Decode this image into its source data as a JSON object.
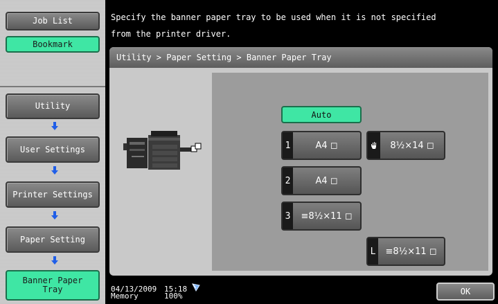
{
  "header": {
    "message_line1": "Specify the banner paper tray to be used when it is not specified",
    "message_line2": "from the printer driver."
  },
  "sidebar": {
    "job_list": "Job List",
    "bookmark": "Bookmark",
    "items": [
      {
        "label": "Utility"
      },
      {
        "label": "User Settings"
      },
      {
        "label": "Printer Settings"
      },
      {
        "label": "Paper Setting"
      },
      {
        "label_line1": "Banner Paper",
        "label_line2": "Tray"
      }
    ]
  },
  "breadcrumb": "Utility > Paper Setting > Banner Paper Tray",
  "trays": {
    "auto": "Auto",
    "tray1": {
      "num": "1",
      "size": "A4 ◻"
    },
    "tray2": {
      "num": "2",
      "size": "A4 ◻"
    },
    "tray3": {
      "num": "3",
      "size": "≡8½×11 ◻"
    },
    "bypass": {
      "size": "8½×14 ◻"
    },
    "large": {
      "num": "L",
      "size": "≡8½×11 ◻"
    }
  },
  "footer": {
    "date": "04/13/2009",
    "time": "15:18",
    "memory_label": "Memory",
    "memory_value": "100%",
    "ok": "OK"
  },
  "colors": {
    "accent_green": "#3fe6a4",
    "button_gray": "#6a6a6a",
    "panel_gray": "#c9c9c9"
  }
}
